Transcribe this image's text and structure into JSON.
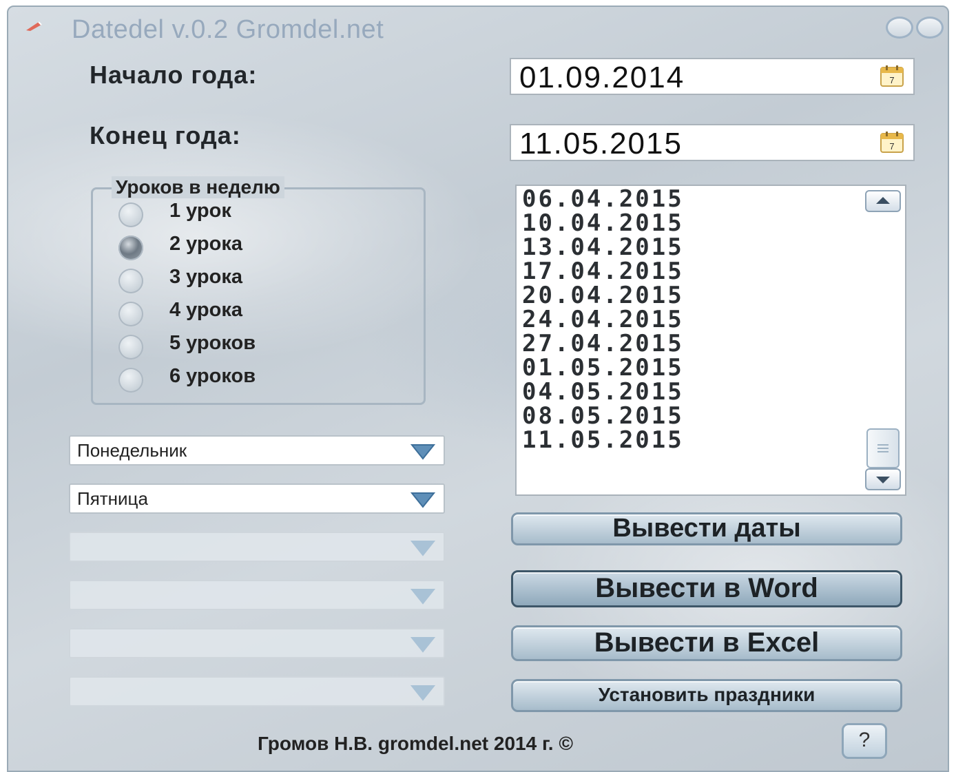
{
  "window": {
    "title": "Datedel v.0.2 Gromdel.net",
    "controls": [
      "minimize-icon",
      "close-icon"
    ]
  },
  "start": {
    "label": "Начало года:",
    "value": "01.09.2014",
    "icon": "calendar-icon"
  },
  "end": {
    "label": "Конец года:",
    "value": "11.05.2015",
    "icon": "calendar-icon"
  },
  "lessons_group": {
    "title": "Уроков в неделю",
    "options": [
      "1 урок",
      "2 урока",
      "3 урока",
      "4 урока",
      "5 уроков",
      "6 уроков"
    ],
    "selected": "2 урока"
  },
  "day_selects": [
    {
      "value": "Понедельник",
      "enabled": true
    },
    {
      "value": "Пятница",
      "enabled": true
    },
    {
      "value": "",
      "enabled": false
    },
    {
      "value": "",
      "enabled": false
    },
    {
      "value": "",
      "enabled": false
    },
    {
      "value": "",
      "enabled": false
    }
  ],
  "dates_list": [
    "06.04.2015",
    "10.04.2015",
    "13.04.2015",
    "17.04.2015",
    "20.04.2015",
    "24.04.2015",
    "27.04.2015",
    "01.05.2015",
    "04.05.2015",
    "08.05.2015",
    "11.05.2015"
  ],
  "buttons": {
    "show_dates": "Вывести даты",
    "export_word": "Вывести в Word",
    "export_excel": "Вывести в Excel",
    "set_holidays": "Установить праздники",
    "help": "?"
  },
  "footer": "Громов Н.В. gromdel.net 2014 г. ©",
  "colors": {
    "title_text": "#97a9bd",
    "background": "#cdd5dc",
    "button_border": "#7f97aa"
  }
}
